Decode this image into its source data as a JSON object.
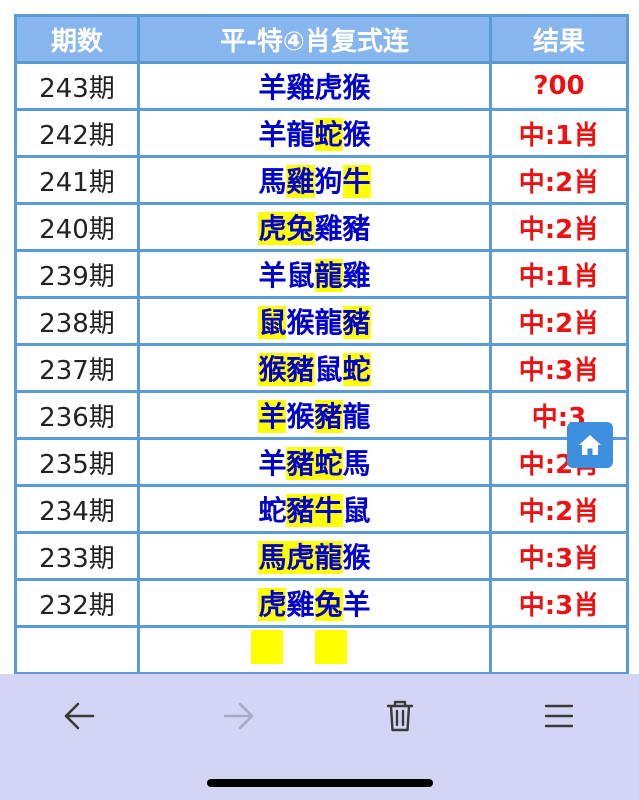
{
  "table": {
    "headers": [
      "期数",
      "平-特④肖复式连",
      "结果"
    ],
    "rows": [
      {
        "period": "243期",
        "animals": [
          "羊",
          "雞",
          "虎",
          "猴"
        ],
        "highlight": [
          false,
          false,
          false,
          false
        ],
        "result": "?00"
      },
      {
        "period": "242期",
        "animals": [
          "羊",
          "龍",
          "蛇",
          "猴"
        ],
        "highlight": [
          false,
          false,
          true,
          false
        ],
        "result": "中:1肖"
      },
      {
        "period": "241期",
        "animals": [
          "馬",
          "雞",
          "狗",
          "牛"
        ],
        "highlight": [
          false,
          true,
          false,
          true
        ],
        "result": "中:2肖"
      },
      {
        "period": "240期",
        "animals": [
          "虎",
          "兔",
          "雞",
          "豬"
        ],
        "highlight": [
          true,
          true,
          false,
          false
        ],
        "result": "中:2肖"
      },
      {
        "period": "239期",
        "animals": [
          "羊",
          "鼠",
          "龍",
          "雞"
        ],
        "highlight": [
          false,
          false,
          true,
          false
        ],
        "result": "中:1肖"
      },
      {
        "period": "238期",
        "animals": [
          "鼠",
          "猴",
          "龍",
          "豬"
        ],
        "highlight": [
          true,
          false,
          false,
          true
        ],
        "result": "中:2肖"
      },
      {
        "period": "237期",
        "animals": [
          "猴",
          "豬",
          "鼠",
          "蛇"
        ],
        "highlight": [
          true,
          true,
          false,
          true
        ],
        "result": "中:3肖"
      },
      {
        "period": "236期",
        "animals": [
          "羊",
          "猴",
          "豬",
          "龍"
        ],
        "highlight": [
          true,
          false,
          true,
          false
        ],
        "result": "中:3"
      },
      {
        "period": "235期",
        "animals": [
          "羊",
          "豬",
          "蛇",
          "馬"
        ],
        "highlight": [
          false,
          true,
          true,
          false
        ],
        "result": "中:2肖"
      },
      {
        "period": "234期",
        "animals": [
          "蛇",
          "豬",
          "牛",
          "鼠"
        ],
        "highlight": [
          false,
          true,
          true,
          false
        ],
        "result": "中:2肖"
      },
      {
        "period": "233期",
        "animals": [
          "馬",
          "虎",
          "龍",
          "猴"
        ],
        "highlight": [
          true,
          true,
          true,
          false
        ],
        "result": "中:3肖"
      },
      {
        "period": "232期",
        "animals": [
          "虎",
          "雞",
          "兔",
          "羊"
        ],
        "highlight": [
          true,
          false,
          true,
          false
        ],
        "result": "中:3肖"
      },
      {
        "period": "",
        "animals": [
          "",
          "",
          "",
          ""
        ],
        "highlight": [
          true,
          false,
          true,
          false
        ],
        "result": ""
      }
    ]
  },
  "floating_button": {
    "icon": "home-icon"
  },
  "toolbar": {
    "buttons": [
      {
        "icon": "back-arrow-icon",
        "enabled": true
      },
      {
        "icon": "forward-arrow-icon",
        "enabled": false
      },
      {
        "icon": "trash-icon",
        "enabled": true
      },
      {
        "icon": "menu-icon",
        "enabled": true
      }
    ]
  },
  "colors": {
    "header_bg": "#87b5ee",
    "border": "#5b9bd5",
    "animal_text": "#0000cc",
    "result_text": "#ee1111",
    "highlight": "#ffff00",
    "toolbar_bg": "#d4d4f4",
    "fab_bg": "#3d8fe0"
  }
}
